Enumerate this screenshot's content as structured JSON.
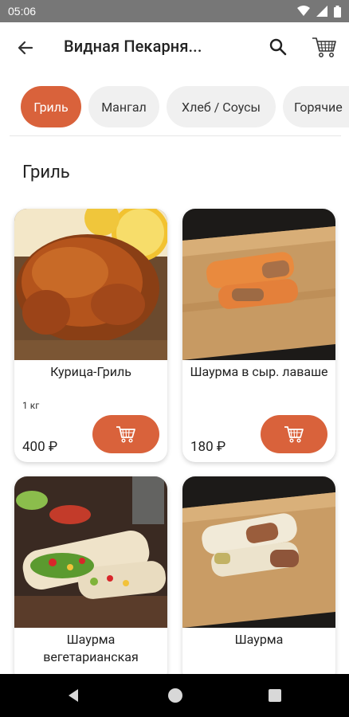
{
  "status_bar": {
    "time": "05:06"
  },
  "app_bar": {
    "title": "Видная Пекарня..."
  },
  "categories": [
    {
      "label": "Гриль",
      "active": true
    },
    {
      "label": "Мангал",
      "active": false
    },
    {
      "label": "Хлеб / Соусы",
      "active": false
    },
    {
      "label": "Горячие",
      "active": false
    }
  ],
  "section": {
    "title": "Гриль"
  },
  "products": [
    {
      "name": "Курица-Гриль",
      "weight": "1 кг",
      "price": "400 ₽"
    },
    {
      "name": "Шаурма в сыр. лаваше",
      "weight": "",
      "price": "180 ₽"
    },
    {
      "name": "Шаурма вегетарианская",
      "weight": "",
      "price": ""
    },
    {
      "name": "Шаурма",
      "weight": "",
      "price": ""
    }
  ],
  "colors": {
    "accent": "#d9623b",
    "chip_bg": "#f0f0f0",
    "status_bar": "#777777"
  }
}
